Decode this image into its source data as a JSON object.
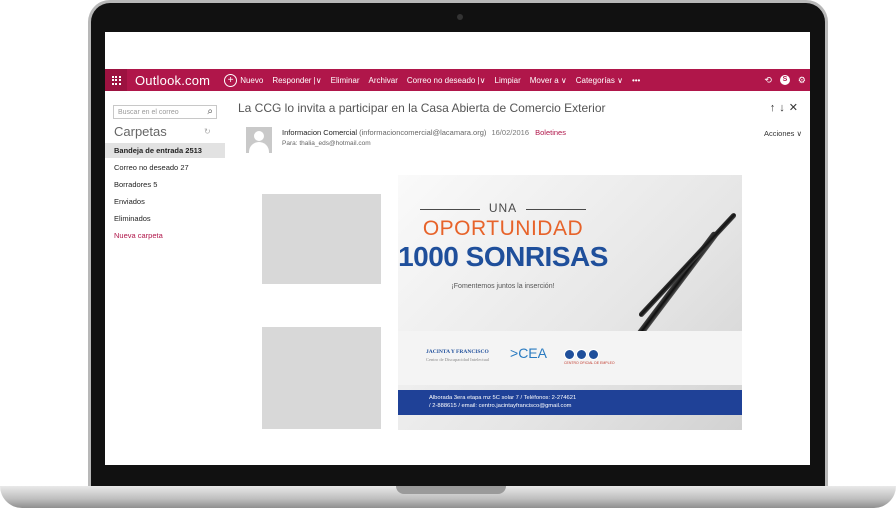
{
  "topbar": {
    "brand": "Outlook.com",
    "commands": [
      "Nuevo",
      "Responder |∨",
      "Eliminar",
      "Archivar",
      "Correo no deseado |∨",
      "Limpiar",
      "Mover a ∨",
      "Categorías ∨",
      "•••"
    ],
    "plus_symbol": "+",
    "right_icons": [
      "undo-icon",
      "skype-icon",
      "settings-icon"
    ],
    "accent": "#b0164a"
  },
  "sidebar": {
    "search_placeholder": "Buscar en el correo",
    "folders_title": "Carpetas",
    "items": [
      {
        "label": "Bandeja de entrada",
        "count": "2513",
        "selected": true
      },
      {
        "label": "Correo no deseado",
        "count": "27",
        "selected": false
      },
      {
        "label": "Borradores",
        "count": "5",
        "selected": false
      },
      {
        "label": "Enviados",
        "count": "",
        "selected": false
      },
      {
        "label": "Eliminados",
        "count": "",
        "selected": false
      }
    ],
    "new_folder": "Nueva carpeta"
  },
  "message": {
    "subject": "La CCG lo invita a participar en la Casa Abierta de Comercio Exterior",
    "sender_name": "Informacion Comercial",
    "sender_address": "(informacioncomercial@lacamara.org)",
    "date": "16/02/2016",
    "tag": "Boletines",
    "to": "Para: thalia_eds@hotmail.com",
    "actions": "Acciones ∨"
  },
  "banner": {
    "line1": "UNA",
    "line2": "OPORTUNIDAD",
    "line3": "1000 SONRISAS",
    "line4": "¡Fomentemos juntos la inserción!",
    "logo_jf": "JACINTA Y FRANCISCO",
    "logo_jf_sub": "Centro de Discapacidad Intelectual",
    "logo_cea": "CEA",
    "logo_ccc_sub": "CENTRO OFICIAL DE EMPLEO",
    "footer_line1": "Alborada 3era etapa mz 5C solar 7 / Teléfonos: 2-274621",
    "footer_line2": "/ 2-888615 / email: centro.jacintayfrancisco@gmail.com"
  }
}
